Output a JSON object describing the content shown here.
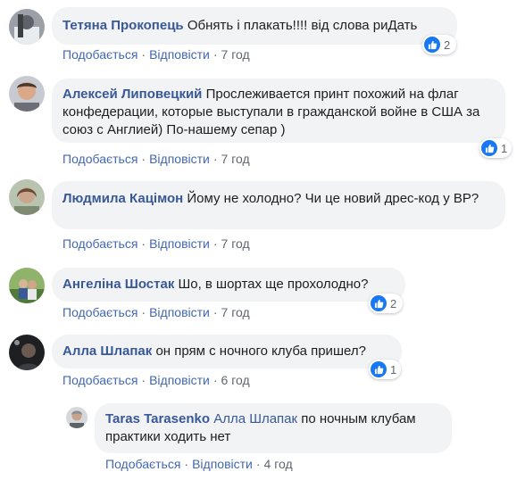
{
  "comments": [
    {
      "author": "Тетяна Прокопець",
      "text": "Обнять і плакать!!!! від слова риДать",
      "reactions": "2",
      "like": "Подобається",
      "reply": "Відповісти",
      "time": "7 год"
    },
    {
      "author": "Алексей Липовецкий",
      "text": "Прослеживается принт похожий на флаг конфедерации, которые выступали в гражданской войне в США за союз с Англией) По-нашему сепар )",
      "reactions": "1",
      "like": "Подобається",
      "reply": "Відповісти",
      "time": "7 год"
    },
    {
      "author": "Людмила Кацімон",
      "text": "Йому не холодно? Чи це новий дрес-код у ВР?",
      "like": "Подобається",
      "reply": "Відповісти",
      "time": "7 год"
    },
    {
      "author": "Ангеліна Шостак",
      "text": "Шо, в шортах ще прохолодно?",
      "reactions": "2",
      "like": "Подобається",
      "reply": "Відповісти",
      "time": "7 год"
    },
    {
      "author": "Алла Шлапак",
      "text": "он прям с ночного клуба пришел?",
      "reactions": "1",
      "like": "Подобається",
      "reply": "Відповісти",
      "time": "6 год"
    }
  ],
  "reply": {
    "author": "Taras Tarasenko",
    "mention": "Алла Шлапак",
    "text": "по ночным клубам практики ходить нет",
    "like": "Подобається",
    "reply": "Відповісти",
    "time": "4 год"
  },
  "colors": {
    "link": "#385898",
    "bubble": "#f2f3f5",
    "like_blue": "#1877f2",
    "meta": "#606770"
  },
  "icons": {
    "reaction": "thumbs-up-icon",
    "separator": "·"
  }
}
